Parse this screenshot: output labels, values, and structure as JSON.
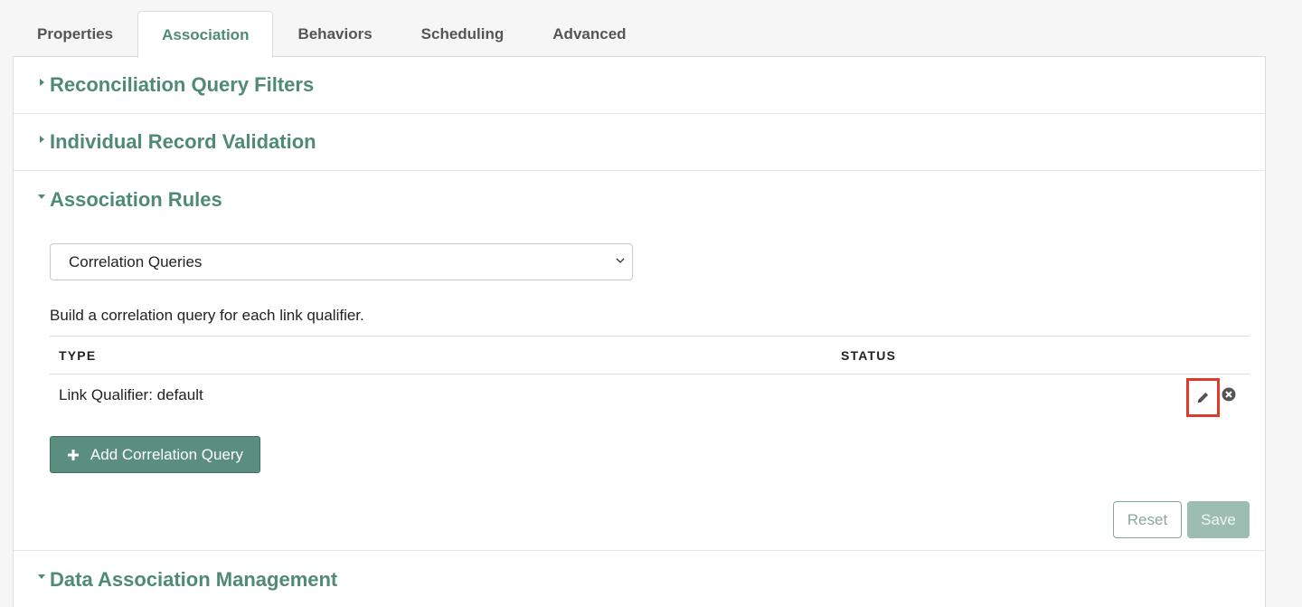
{
  "tabs": [
    {
      "label": "Properties",
      "active": false
    },
    {
      "label": "Association",
      "active": true
    },
    {
      "label": "Behaviors",
      "active": false
    },
    {
      "label": "Scheduling",
      "active": false
    },
    {
      "label": "Advanced",
      "active": false
    }
  ],
  "sections": {
    "reconciliation": {
      "title": "Reconciliation Query Filters",
      "expanded": false
    },
    "validation": {
      "title": "Individual Record Validation",
      "expanded": false
    },
    "association_rules": {
      "title": "Association Rules",
      "expanded": true
    },
    "data_management": {
      "title": "Data Association Management",
      "expanded": true
    }
  },
  "association_rules": {
    "rule_select": {
      "value": "Correlation Queries"
    },
    "description": "Build a correlation query for each link qualifier.",
    "table": {
      "columns": [
        "TYPE",
        "STATUS"
      ],
      "rows": [
        {
          "type": "Link Qualifier: default",
          "status": ""
        }
      ]
    },
    "add_button": "Add Correlation Query",
    "reset_button": "Reset",
    "save_button": "Save"
  },
  "colors": {
    "accent": "#4f8a78",
    "button": "#5a8f7f",
    "highlight": "#e03a2c"
  },
  "icons": {
    "edit": "pencil-icon",
    "delete": "close-circle-icon",
    "add": "plus-icon"
  }
}
